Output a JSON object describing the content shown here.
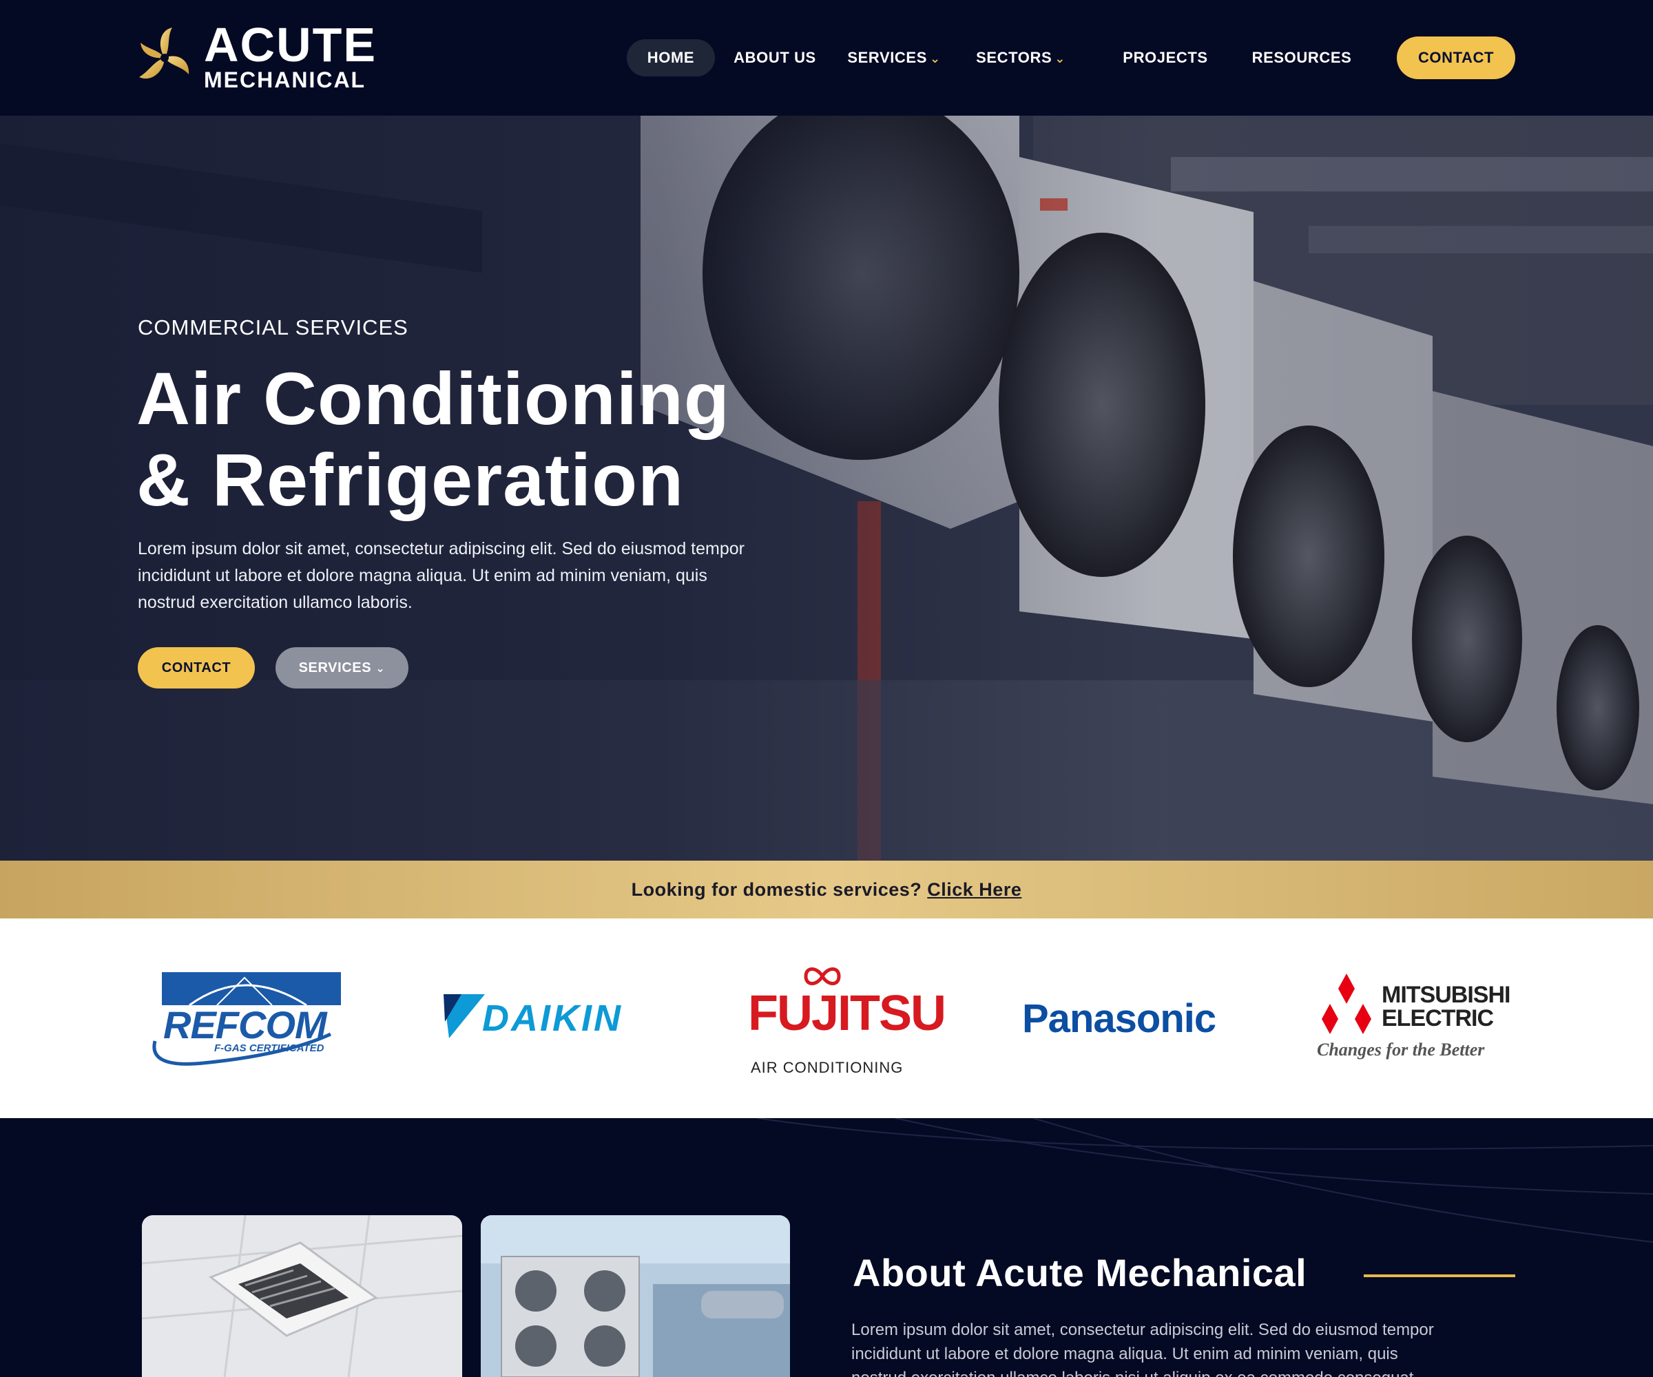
{
  "brand": {
    "name_line1": "ACUTE",
    "name_line2": "MECHANICAL",
    "accent": "#f2c34e",
    "navy": "#050a24"
  },
  "nav": {
    "items": [
      {
        "label": "HOME",
        "active": true
      },
      {
        "label": "ABOUT US",
        "active": false
      },
      {
        "label": "SERVICES",
        "active": false,
        "dropdown": true
      },
      {
        "label": "SECTORS",
        "active": false,
        "dropdown": true
      },
      {
        "label": "PROJECTS",
        "active": false
      },
      {
        "label": "RESOURCES",
        "active": false
      }
    ],
    "cta_label": "CONTACT",
    "dropdown_icon": "chevron-down-icon"
  },
  "hero": {
    "eyebrow": "COMMERCIAL SERVICES",
    "title_line1": "Air Conditioning",
    "title_line2": "& Refrigeration",
    "text": "Lorem ipsum dolor sit amet, consectetur adipiscing elit. Sed do eiusmod tempor incididunt ut labore et dolore magna aliqua. Ut enim ad minim veniam, quis nostrud exercitation ullamco laboris.",
    "contact_label": "CONTACT",
    "services_label": "SERVICES"
  },
  "strip": {
    "text": "Looking for domestic services?",
    "link": "Click Here"
  },
  "partners": {
    "refcom_name": "REFCOM",
    "refcom_sub": "F-GAS CERTIFICATED",
    "daikin": "DAIKIN",
    "fujitsu": "FUJITSU",
    "fujitsu_sub": "AIR CONDITIONING",
    "panasonic": "Panasonic",
    "mitsubishi_line1": "MITSUBISHI",
    "mitsubishi_line2": "ELECTRIC",
    "mitsubishi_tagline": "Changes for the Better"
  },
  "about": {
    "title": "About Acute Mechanical",
    "text": "Lorem ipsum dolor sit amet, consectetur adipiscing elit. Sed do eiusmod tempor incididunt ut labore et dolore magna aliqua. Ut enim ad minim veniam, quis nostrud exercitation ullamco laboris nisi ut aliquip ex ea commodo consequat. Duis aute"
  }
}
